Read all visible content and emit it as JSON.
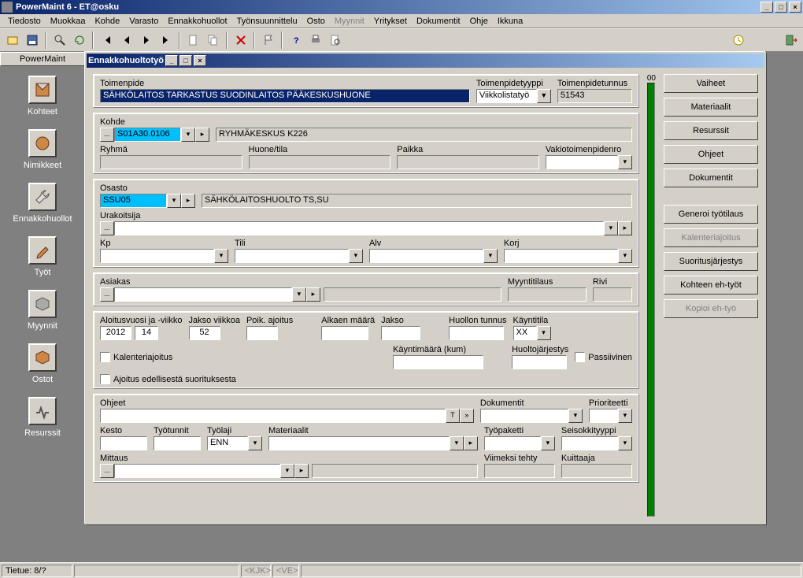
{
  "window": {
    "title": "PowerMaint 6 - ET@osku"
  },
  "menu": [
    "Tiedosto",
    "Muokkaa",
    "Kohde",
    "Varasto",
    "Ennakkohuollot",
    "Työnsuunnittelu",
    "Osto",
    "Myynnit",
    "Yritykset",
    "Dokumentit",
    "Ohje",
    "Ikkuna"
  ],
  "menu_disabled_index": 7,
  "sidebar": {
    "tab": "PowerMaint",
    "items": [
      "Kohteet",
      "Nimikkeet",
      "Ennakkohuollot",
      "Työt",
      "Myynnit",
      "Ostot",
      "Resurssit"
    ]
  },
  "mdi": {
    "title": "Ennakkohuoltotyö"
  },
  "form": {
    "toimenpide_label": "Toimenpide",
    "toimenpide_value": "SÄHKÖLAITOS TARKASTUS SUODINLAITOS PÄÄKESKUSHUONE",
    "toimenpidetyyppi_label": "Toimenpidetyyppi",
    "toimenpidetyyppi_value": "Viikkolistatyö",
    "toimenpidetunnus_label": "Toimenpidetunnus",
    "toimenpidetunnus_value": "51543",
    "badge00": "00",
    "kohde_label": "Kohde",
    "kohde_value": "S01A30.0106",
    "kohde_desc": "RYHMÄKESKUS K226",
    "ryhma_label": "Ryhmä",
    "huonetila_label": "Huone/tila",
    "paikka_label": "Paikka",
    "vakiotoimen_label": "Vakiotoimenpidenro",
    "osasto_label": "Osasto",
    "osasto_value": "SSU05",
    "osasto_desc": "SÄHKÖLAITOSHUOLTO TS,SU",
    "urakoitsija_label": "Urakoitsija",
    "kp_label": "Kp",
    "tili_label": "Tili",
    "alv_label": "Alv",
    "korj_label": "Korj",
    "asiakas_label": "Asiakas",
    "myyntitilaus_label": "Myyntitilaus",
    "rivi_label": "Rivi",
    "aloitus_label": "Aloitusvuosi ja -viikko",
    "aloitus_vuosi": "2012",
    "aloitus_viikko": "14",
    "jakso_label": "Jakso viikkoa",
    "jakso_value": "52",
    "poik_label": "Poik. ajoitus",
    "kalenteriajoitus_label": "Kalenteriajoitus",
    "ajoitus_edellisesta_label": "Ajoitus edellisestä suorituksesta",
    "alkaenmaara_label": "Alkaen määrä",
    "jakso2_label": "Jakso",
    "kayntimaara_label": "Käyntimäärä (kum)",
    "huollon_label": "Huollon tunnus",
    "kayntitila_label": "Käyntitila",
    "kayntitila_value": "XX",
    "huoltojar_label": "Huoltojärjestys",
    "passiivinen_label": "Passiivinen",
    "ohjeet_label": "Ohjeet",
    "dokumentit_label": "Dokumentit",
    "prioriteetti_label": "Prioriteetti",
    "kesto_label": "Kesto",
    "tyotunnit_label": "Työtunnit",
    "tyolaji_label": "Työlaji",
    "tyolaji_value": "ENN",
    "materiaalit_label": "Materiaalit",
    "tyopaketti_label": "Työpaketti",
    "seisokki_label": "Seisokkityyppi",
    "mittaus_label": "Mittaus",
    "viimeksi_label": "Viimeksi tehty",
    "kuittaaja_label": "Kuittaaja"
  },
  "buttons": {
    "vaiheet": "Vaiheet",
    "materiaalit": "Materiaalit",
    "resurssit": "Resurssit",
    "ohjeet": "Ohjeet",
    "dokumentit": "Dokumentit",
    "generoi": "Generoi työtilaus",
    "kalenteriajoitus": "Kalenteriajoitus",
    "suoritus": "Suoritusjärjestys",
    "kohteen": "Kohteen eh-työt",
    "kopioi": "Kopioi eh-työ"
  },
  "status": {
    "tietue": "Tietue: 8/?",
    "kjk": "<KJK>",
    "ve": "<VE>"
  }
}
